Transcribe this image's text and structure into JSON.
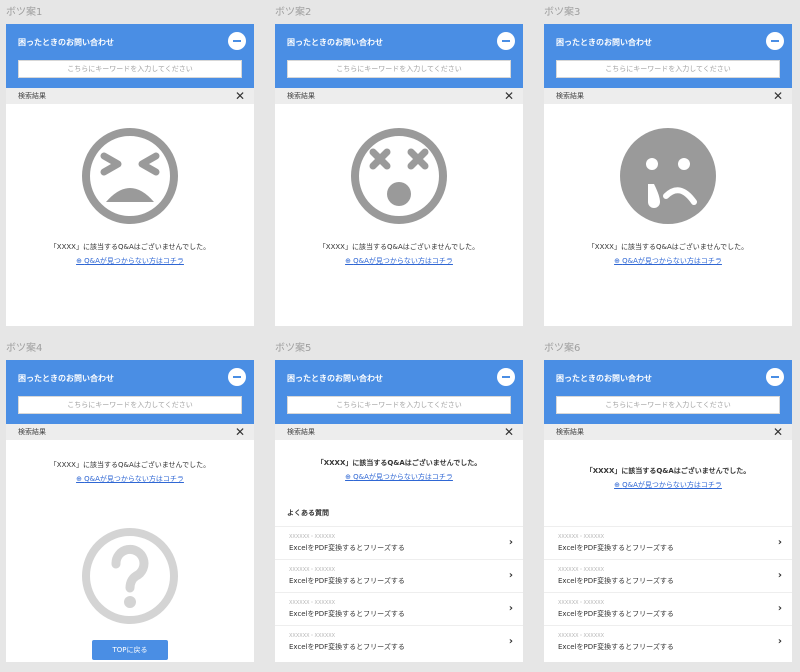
{
  "shared": {
    "header_title": "困ったときのお問い合わせ",
    "search_placeholder": "こちらにキーワードを入力してください",
    "results_label": "検索結果",
    "no_result_message": "「XXXX」に該当するQ&Aはございませんでした。",
    "help_link": "Q&Aが見つからない方はコチラ",
    "icon_color": "#9a9a9a",
    "accent_color": "#4a8ee4"
  },
  "variants": [
    {
      "title": "ボツ案1",
      "face_icon": "grimace-face-icon"
    },
    {
      "title": "ボツ案2",
      "face_icon": "dizzy-face-icon"
    },
    {
      "title": "ボツ案3",
      "face_icon": "crying-face-icon"
    },
    {
      "title": "ボツ案4",
      "face_icon": "question-circle-icon",
      "top_button": "TOPに戻る"
    },
    {
      "title": "ボツ案5",
      "faq_heading": "よくある質問",
      "faq_items": [
        {
          "category": "XXXXXX・XXXXXX",
          "question": "ExcelをPDF変換するとフリーズする"
        },
        {
          "category": "XXXXXX・XXXXXX",
          "question": "ExcelをPDF変換するとフリーズする"
        },
        {
          "category": "XXXXXX・XXXXXX",
          "question": "ExcelをPDF変換するとフリーズする"
        },
        {
          "category": "XXXXXX・XXXXXX",
          "question": "ExcelをPDF変換するとフリーズする"
        }
      ]
    },
    {
      "title": "ボツ案6",
      "faq_items": [
        {
          "category": "XXXXXX・XXXXXX",
          "question": "ExcelをPDF変換するとフリーズする"
        },
        {
          "category": "XXXXXX・XXXXXX",
          "question": "ExcelをPDF変換するとフリーズする"
        },
        {
          "category": "XXXXXX・XXXXXX",
          "question": "ExcelをPDF変換するとフリーズする"
        },
        {
          "category": "XXXXXX・XXXXXX",
          "question": "ExcelをPDF変換するとフリーズする"
        }
      ]
    }
  ]
}
